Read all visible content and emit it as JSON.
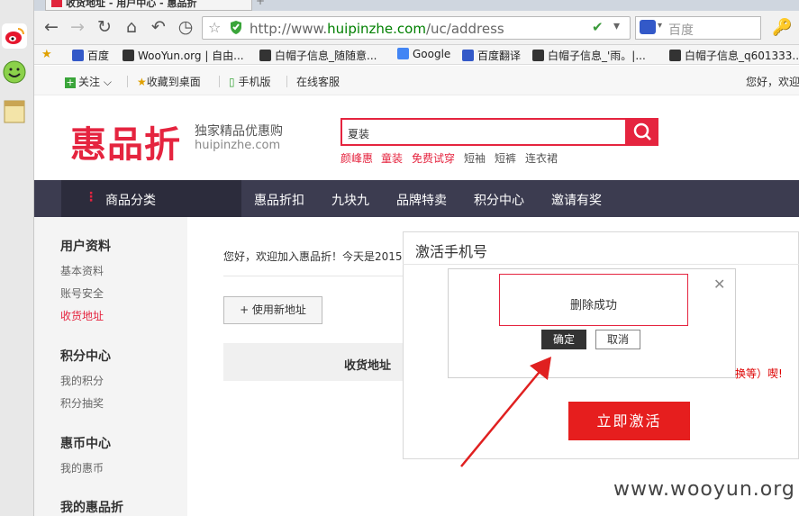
{
  "browser": {
    "tab_title": "收货地址 - 用户中心 - 惠品折",
    "new_tab": "+",
    "url_prefix": "http://www.",
    "url_domain": "huipinzhe.com",
    "url_path": "/uc/address",
    "search_engine": "百度",
    "bookmarks": [
      "百度",
      "WooYun.org | 自由...",
      "白帽子信息_随随意...",
      "Google",
      "百度翻译",
      "白帽子信息_'雨。|...",
      "白帽子信息_q601333..."
    ]
  },
  "topbar": {
    "follow": "关注",
    "bookmark_desktop": "收藏到桌面",
    "mobile": "手机版",
    "service": "在线客服",
    "greeting": "您好，欢迎"
  },
  "header": {
    "logo": "惠品折",
    "slogan": "独家精品优惠购",
    "domain": "huipinzhe.com",
    "search_value": "夏装",
    "hot_words": [
      "颜峰惠",
      "童装",
      "免费试穿",
      "短袖",
      "短裤",
      "连衣裙"
    ]
  },
  "nav": {
    "category": "商品分类",
    "items": [
      "惠品折扣",
      "九块九",
      "品牌特卖",
      "积分中心",
      "邀请有奖"
    ]
  },
  "sidebar": {
    "groups": [
      {
        "title": "用户资料",
        "items": [
          "基本资料",
          "账号安全",
          "收货地址"
        ]
      },
      {
        "title": "积分中心",
        "items": [
          "我的积分",
          "积分抽奖"
        ]
      },
      {
        "title": "惠币中心",
        "items": [
          "我的惠币"
        ]
      },
      {
        "title": "我的惠品折",
        "items": []
      }
    ]
  },
  "main": {
    "welcome": "您好，欢迎加入惠品折！今天是2015年",
    "add_address": "+ 使用新地址",
    "col_address": "收货地址"
  },
  "dialog": {
    "title": "激活手机号",
    "message": "删除成功",
    "ok": "确定",
    "cancel": "取消",
    "tip_tail": "换等）喫!",
    "activate": "立即激活"
  },
  "watermark": "www.wooyun.org",
  "colors": {
    "brand": "#e5243f",
    "nav_bg": "#3c3c50",
    "activate": "#e61e1e"
  }
}
